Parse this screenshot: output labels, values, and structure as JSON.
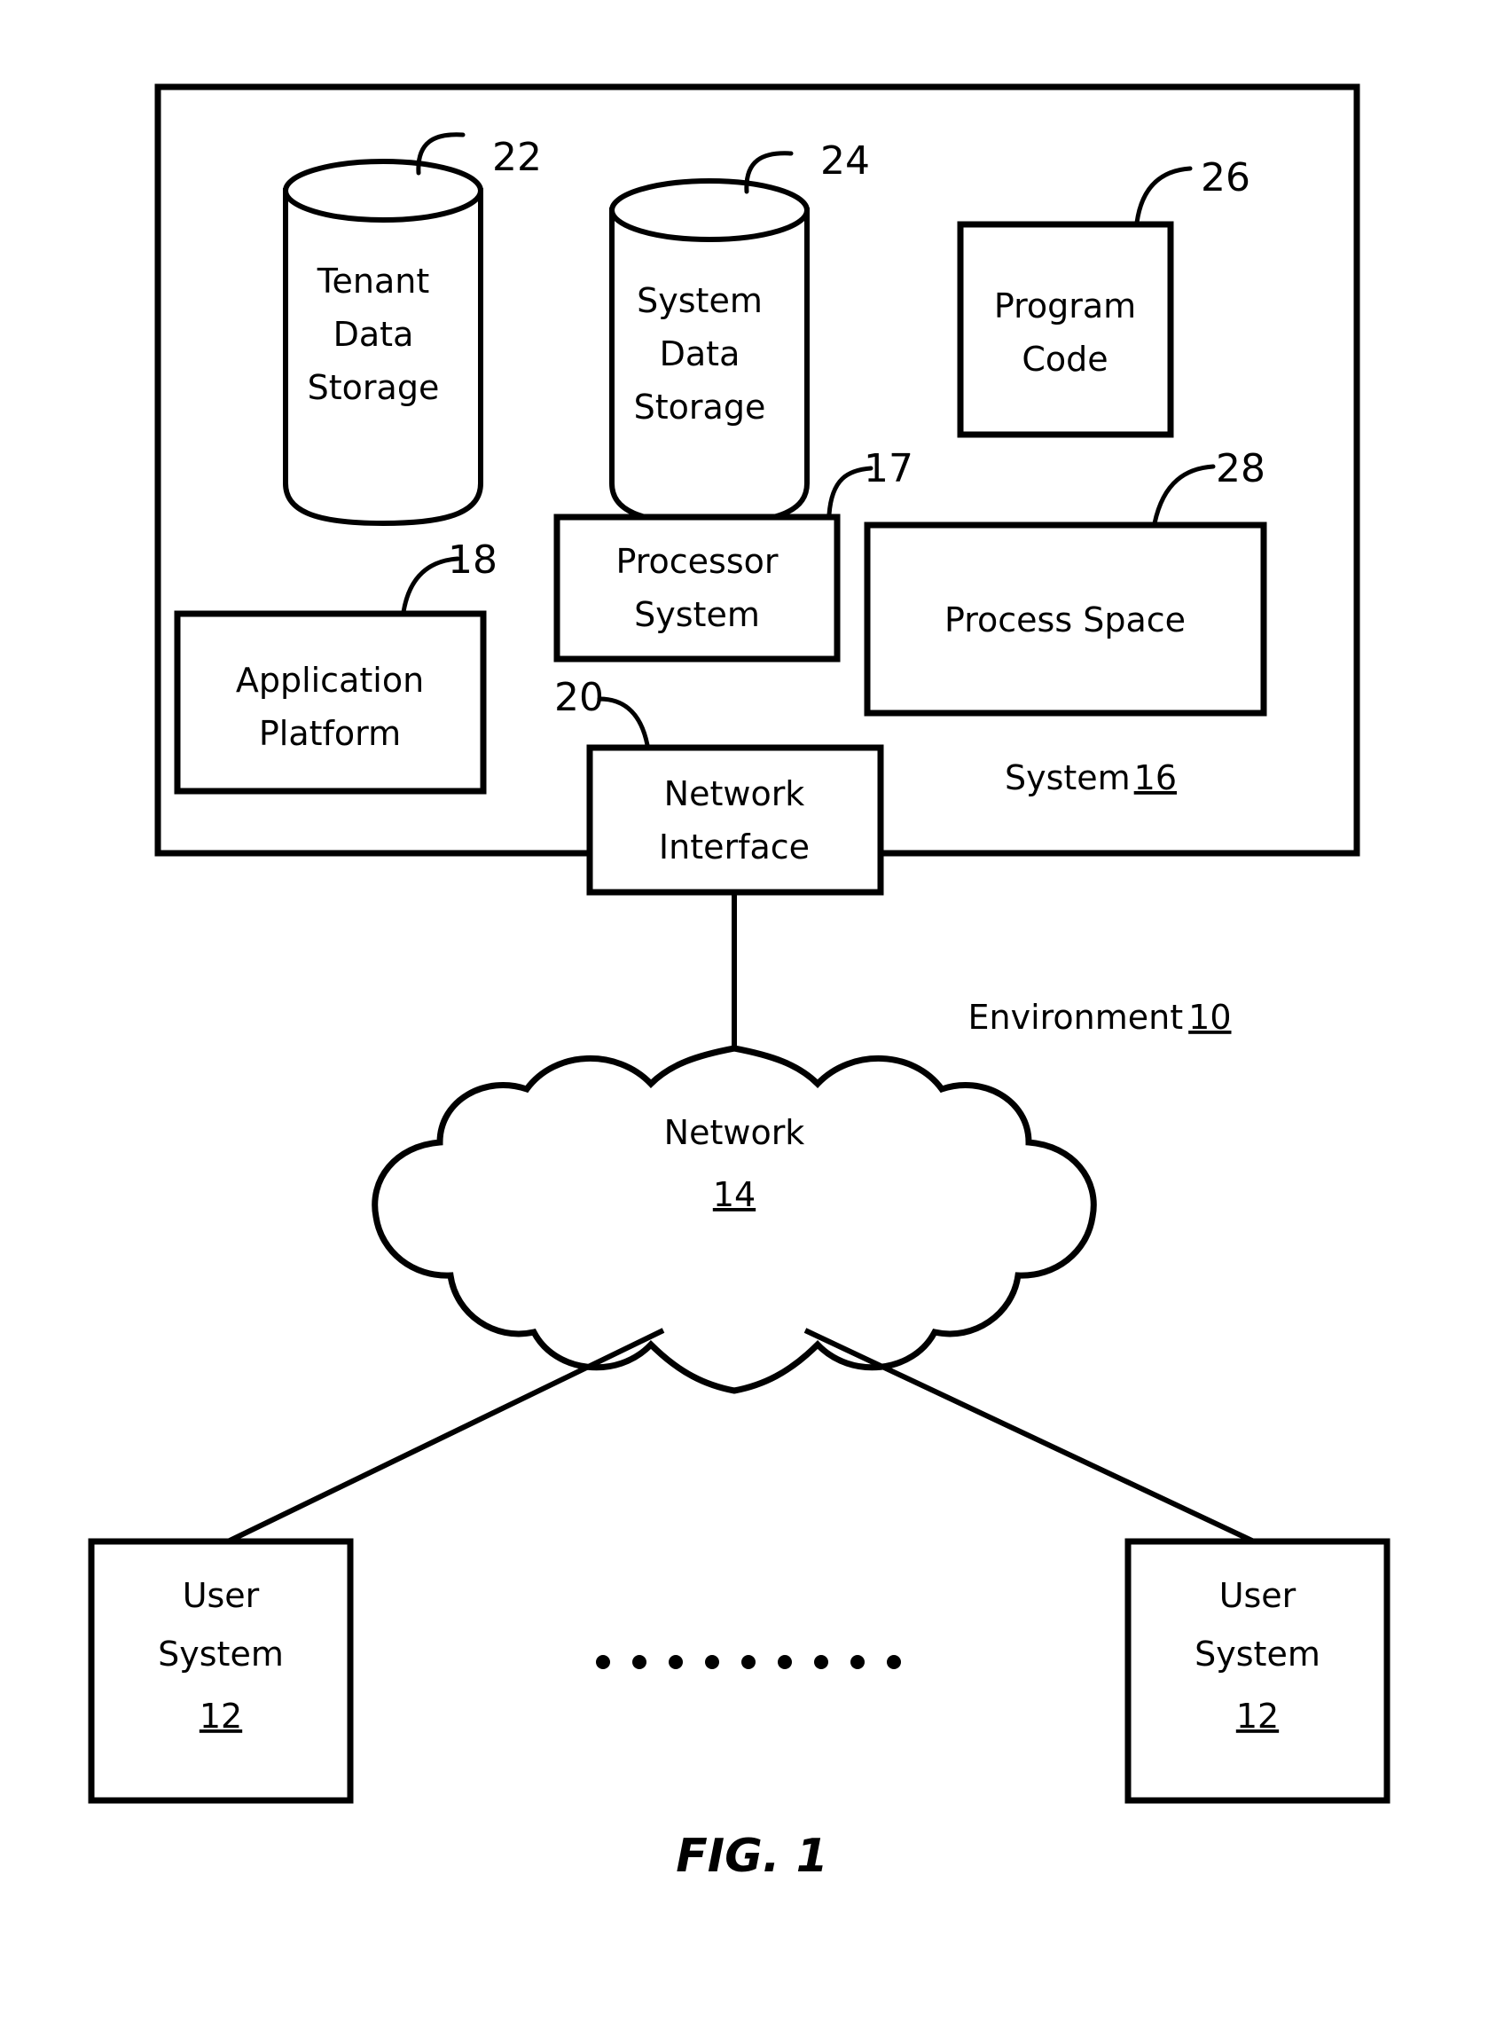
{
  "figure": {
    "caption": "FIG. 1",
    "environment_label": "Environment",
    "environment_ref": "10"
  },
  "system_boundary": {
    "name_label": "System",
    "ref": "16"
  },
  "nodes": {
    "tenant_data_storage": {
      "line1": "Tenant",
      "line2": "Data",
      "line3": "Storage",
      "ref": "22",
      "shape": "cylinder"
    },
    "system_data_storage": {
      "line1": "System",
      "line2": "Data",
      "line3": "Storage",
      "ref": "24",
      "shape": "cylinder"
    },
    "program_code": {
      "line1": "Program",
      "line2": "Code",
      "ref": "26",
      "shape": "rect"
    },
    "processor_system": {
      "line1": "Processor",
      "line2": "System",
      "ref": "17",
      "shape": "rect"
    },
    "process_space": {
      "line1": "Process Space",
      "ref": "28",
      "shape": "rect"
    },
    "application_platform": {
      "line1": "Application",
      "line2": "Platform",
      "ref": "18",
      "shape": "rect"
    },
    "network_interface": {
      "line1": "Network",
      "line2": "Interface",
      "ref": "20",
      "shape": "rect"
    },
    "network_cloud": {
      "line1": "Network",
      "ref": "14",
      "shape": "cloud"
    },
    "user_system_left": {
      "line1": "User",
      "line2": "System",
      "ref": "12",
      "shape": "rect"
    },
    "user_system_right": {
      "line1": "User",
      "line2": "System",
      "ref": "12",
      "shape": "rect"
    }
  },
  "ellipsis": {
    "dot_count": 9,
    "meaning": "additional user systems"
  },
  "colors": {
    "stroke": "#000000",
    "background": "#ffffff"
  }
}
